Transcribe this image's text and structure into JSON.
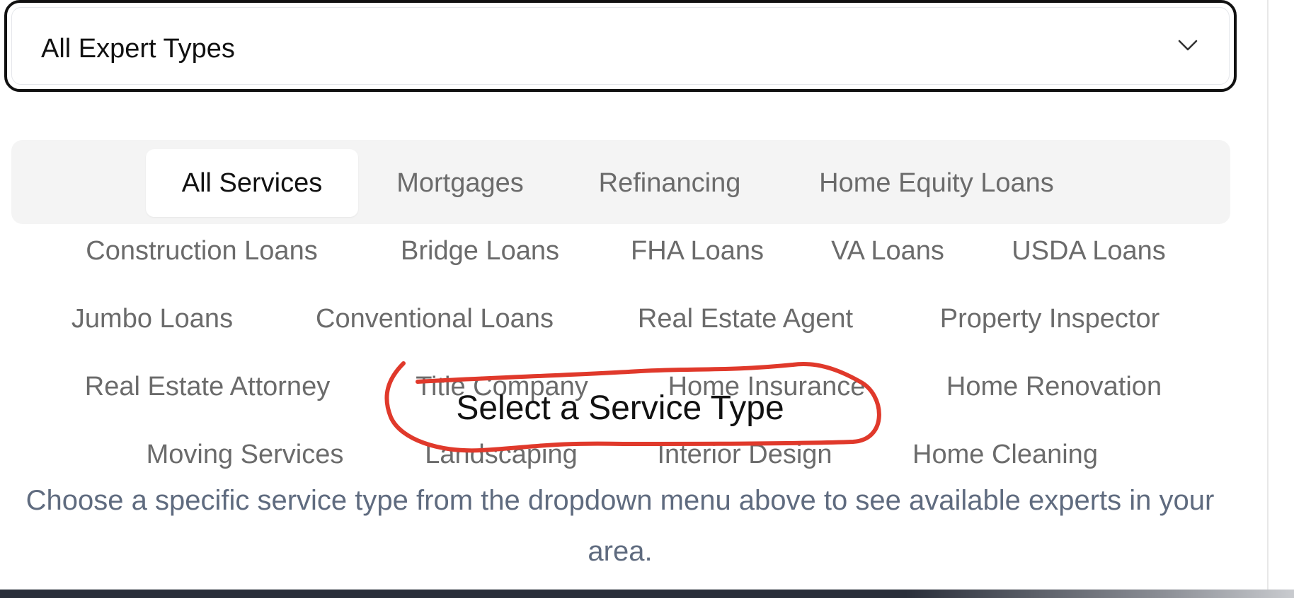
{
  "select": {
    "value": "All Expert Types",
    "icon": "chevron-down-icon"
  },
  "tabs": [
    {
      "label": "All Services",
      "active": true
    },
    {
      "label": "Mortgages"
    },
    {
      "label": "Refinancing"
    },
    {
      "label": "Home Equity Loans"
    },
    {
      "label": "Construction Loans"
    },
    {
      "label": "Bridge Loans"
    },
    {
      "label": "FHA Loans"
    },
    {
      "label": "VA Loans"
    },
    {
      "label": "USDA Loans"
    },
    {
      "label": "Jumbo Loans"
    },
    {
      "label": "Conventional Loans"
    },
    {
      "label": "Real Estate Agent"
    },
    {
      "label": "Property Inspector"
    },
    {
      "label": "Real Estate Attorney"
    },
    {
      "label": "Title Company"
    },
    {
      "label": "Home Insurance"
    },
    {
      "label": "Home Renovation"
    },
    {
      "label": "Moving Services"
    },
    {
      "label": "Landscaping"
    },
    {
      "label": "Interior Design"
    },
    {
      "label": "Home Cleaning"
    }
  ],
  "empty_state": {
    "title": "Select a Service Type",
    "description": "Choose a specific service type from the dropdown menu above to see available experts in your area."
  },
  "colors": {
    "annotation": "#e0392b",
    "muted_text": "#5f6b7f",
    "tab_text": "#6b6b6b"
  }
}
